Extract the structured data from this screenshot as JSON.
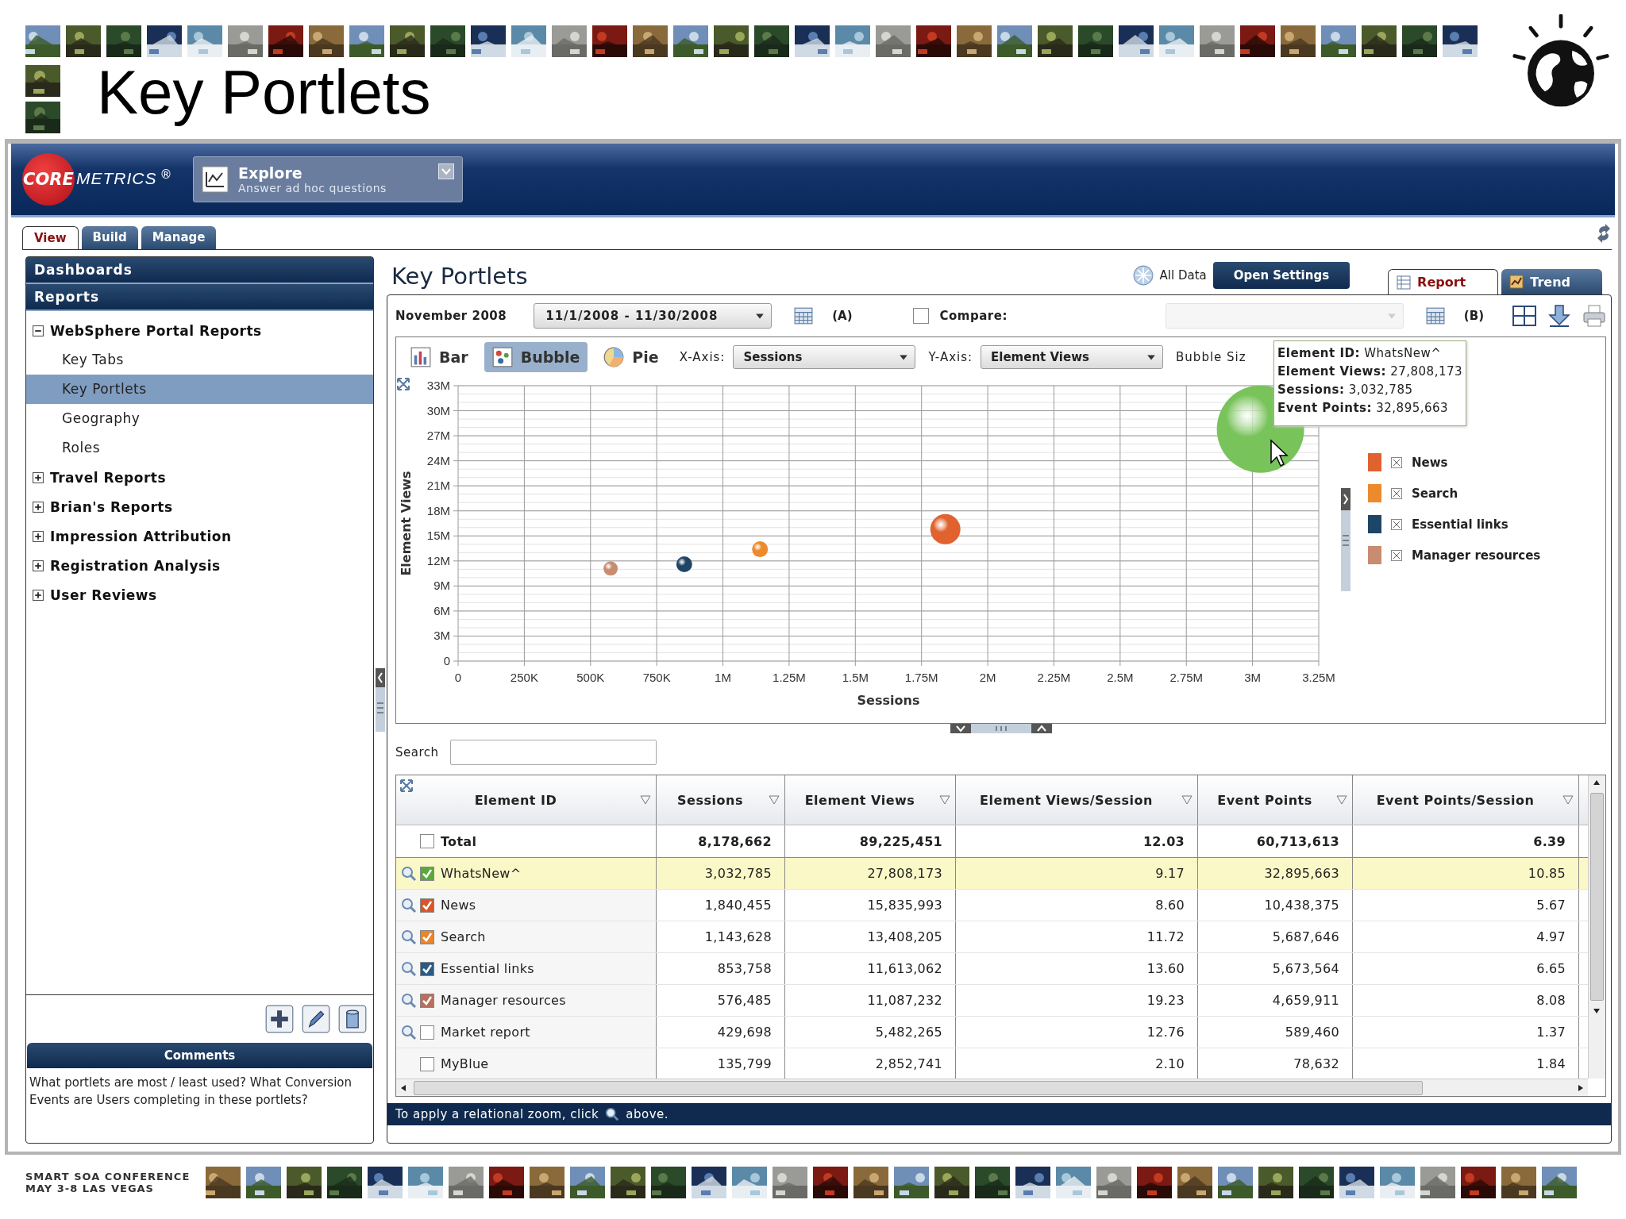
{
  "slide": {
    "title": "Key Portlets",
    "footer_lines": [
      "SMART SOA CONFERENCE",
      "MAY 3-8  LAS VEGAS"
    ]
  },
  "app": {
    "brand": {
      "first": "CORE",
      "second": "METRICS",
      "mark": "®"
    },
    "module": {
      "title": "Explore",
      "subtitle": "Answer ad hoc questions"
    },
    "tabs": [
      {
        "label": "View",
        "selected": true
      },
      {
        "label": "Build",
        "selected": false
      },
      {
        "label": "Manage",
        "selected": false
      }
    ],
    "sidebar": {
      "sections": [
        "Dashboards",
        "Reports"
      ],
      "tree": [
        {
          "label": "WebSphere Portal Reports",
          "expanded": true,
          "selected": false,
          "children": [
            {
              "label": "Key Tabs",
              "selected": false
            },
            {
              "label": "Key Portlets",
              "selected": true
            },
            {
              "label": "Geography",
              "selected": false
            },
            {
              "label": "Roles",
              "selected": false
            }
          ]
        },
        {
          "label": "Travel Reports",
          "expanded": false,
          "selected": false
        },
        {
          "label": "Brian's Reports",
          "expanded": false,
          "selected": false
        },
        {
          "label": "Impression Attribution",
          "expanded": false,
          "selected": false
        },
        {
          "label": "Registration Analysis",
          "expanded": false,
          "selected": false
        },
        {
          "label": "User Reviews",
          "expanded": false,
          "selected": false
        }
      ],
      "comments": {
        "title": "Comments",
        "text": "What portlets are most / least used?  What Conversion Events are Users completing in these portlets?"
      }
    },
    "report": {
      "title": "Key Portlets",
      "all_data": "All Data",
      "open_settings": "Open Settings",
      "view_tabs": [
        {
          "label": "Report",
          "selected": true
        },
        {
          "label": "Trend",
          "selected": false
        }
      ],
      "period": "November 2008",
      "date_range": "11/1/2008 - 11/30/2008",
      "range_a": "(A)",
      "compare": {
        "label": "Compare:",
        "checked": false
      },
      "range_b": "(B)"
    },
    "chart": {
      "types": [
        {
          "label": "Bar",
          "selected": false
        },
        {
          "label": "Bubble",
          "selected": true
        },
        {
          "label": "Pie",
          "selected": false
        }
      ],
      "x_axis": {
        "label": "X-Axis:",
        "value": "Sessions"
      },
      "y_axis": {
        "label": "Y-Axis:",
        "value": "Element Views"
      },
      "bubble_size_label": "Bubble Siz",
      "tooltip": [
        {
          "label": "Element ID:",
          "value": "WhatsNew^"
        },
        {
          "label": "Element Views:",
          "value": "27,808,173"
        },
        {
          "label": "Sessions:",
          "value": "3,032,785"
        },
        {
          "label": "Event Points:",
          "value": "32,895,663"
        }
      ],
      "legend": [
        {
          "label": "News",
          "color": "#e0622e"
        },
        {
          "label": "Search",
          "color": "#ec8a2c"
        },
        {
          "label": "Essential links",
          "color": "#1f4566"
        },
        {
          "label": "Manager resources",
          "color": "#c98c70"
        }
      ],
      "chart_data": {
        "type": "scatter",
        "xlabel": "Sessions",
        "ylabel": "Element Views",
        "x": [
          3030000,
          1840000,
          1140000,
          854000,
          576000
        ],
        "series": [
          {
            "color": "#78c35a",
            "values": [
              27800000,
              null,
              null,
              null,
              null
            ]
          },
          {
            "color": "#e0622e",
            "values": [
              null,
              15800000,
              null,
              null,
              null
            ]
          },
          {
            "color": "#ec8a2c",
            "values": [
              null,
              null,
              13400000,
              null,
              null
            ]
          },
          {
            "color": "#1f4566",
            "values": [
              null,
              null,
              null,
              11600000,
              null
            ]
          },
          {
            "color": "#c98c70",
            "values": [
              null,
              null,
              null,
              null,
              11100000
            ]
          }
        ],
        "grid": true,
        "xlim": [
          0,
          3250000
        ],
        "ylim": [
          0,
          33000000
        ],
        "xticks": [
          {
            "value": 0,
            "label": "0"
          },
          {
            "value": 250000,
            "label": "250K"
          },
          {
            "value": 500000,
            "label": "500K"
          },
          {
            "value": 750000,
            "label": "750K"
          },
          {
            "value": 1000000,
            "label": "1M"
          },
          {
            "value": 1250000,
            "label": "1.25M"
          },
          {
            "value": 1500000,
            "label": "1.5M"
          },
          {
            "value": 1750000,
            "label": "1.75M"
          },
          {
            "value": 2000000,
            "label": "2M"
          },
          {
            "value": 2250000,
            "label": "2.25M"
          },
          {
            "value": 2500000,
            "label": "2.5M"
          },
          {
            "value": 2750000,
            "label": "2.75M"
          },
          {
            "value": 3000000,
            "label": "3M"
          },
          {
            "value": 3250000,
            "label": "3.25M"
          }
        ],
        "yticks": [
          {
            "value": 0,
            "label": "0"
          },
          {
            "value": 3000000,
            "label": "3M"
          },
          {
            "value": 6000000,
            "label": "6M"
          },
          {
            "value": 9000000,
            "label": "9M"
          },
          {
            "value": 12000000,
            "label": "12M"
          },
          {
            "value": 15000000,
            "label": "15M"
          },
          {
            "value": 18000000,
            "label": "18M"
          },
          {
            "value": 21000000,
            "label": "21M"
          },
          {
            "value": 24000000,
            "label": "24M"
          },
          {
            "value": 27000000,
            "label": "27M"
          },
          {
            "value": 30000000,
            "label": "30M"
          },
          {
            "value": 33000000,
            "label": "33M"
          }
        ]
      }
    },
    "table": {
      "search_label": "Search",
      "columns": [
        "Element ID",
        "Sessions",
        "Element Views",
        "Element Views/Session",
        "Event Points",
        "Event Points/Session"
      ],
      "rows": [
        {
          "kind": "total",
          "checked": false,
          "selected": false,
          "zoom": false,
          "cells": [
            "Total",
            "8,178,662",
            "89,225,451",
            "12.03",
            "60,713,613",
            "6.39"
          ]
        },
        {
          "kind": "item",
          "checked": true,
          "color": "#5aa83c",
          "selected": true,
          "zoom": true,
          "cells": [
            "WhatsNew^",
            "3,032,785",
            "27,808,173",
            "9.17",
            "32,895,663",
            "10.85"
          ]
        },
        {
          "kind": "item",
          "checked": true,
          "color": "#d9552a",
          "selected": false,
          "zoom": true,
          "cells": [
            "News",
            "1,840,455",
            "15,835,993",
            "8.60",
            "10,438,375",
            "5.67"
          ]
        },
        {
          "kind": "item",
          "checked": true,
          "color": "#e9852a",
          "selected": false,
          "zoom": true,
          "cells": [
            "Search",
            "1,143,628",
            "13,408,205",
            "11.72",
            "5,687,646",
            "4.97"
          ]
        },
        {
          "kind": "item",
          "checked": true,
          "color": "#2a5a85",
          "selected": false,
          "zoom": true,
          "cells": [
            "Essential links",
            "853,758",
            "11,613,062",
            "13.60",
            "5,673,564",
            "6.65"
          ]
        },
        {
          "kind": "item",
          "checked": true,
          "color": "#b8705c",
          "selected": false,
          "zoom": true,
          "cells": [
            "Manager resources",
            "576,485",
            "11,087,232",
            "19.23",
            "4,659,911",
            "8.08"
          ]
        },
        {
          "kind": "item",
          "checked": false,
          "selected": false,
          "zoom": true,
          "cells": [
            "Market report",
            "429,698",
            "5,482,265",
            "12.76",
            "589,460",
            "1.37"
          ]
        },
        {
          "kind": "item",
          "checked": false,
          "selected": false,
          "zoom": false,
          "cells": [
            "MyBlue",
            "135,799",
            "2,852,741",
            "2.10",
            "78,632",
            "1.84"
          ]
        }
      ]
    },
    "status": {
      "before": "To apply a relational zoom, click",
      "after": "above."
    }
  }
}
